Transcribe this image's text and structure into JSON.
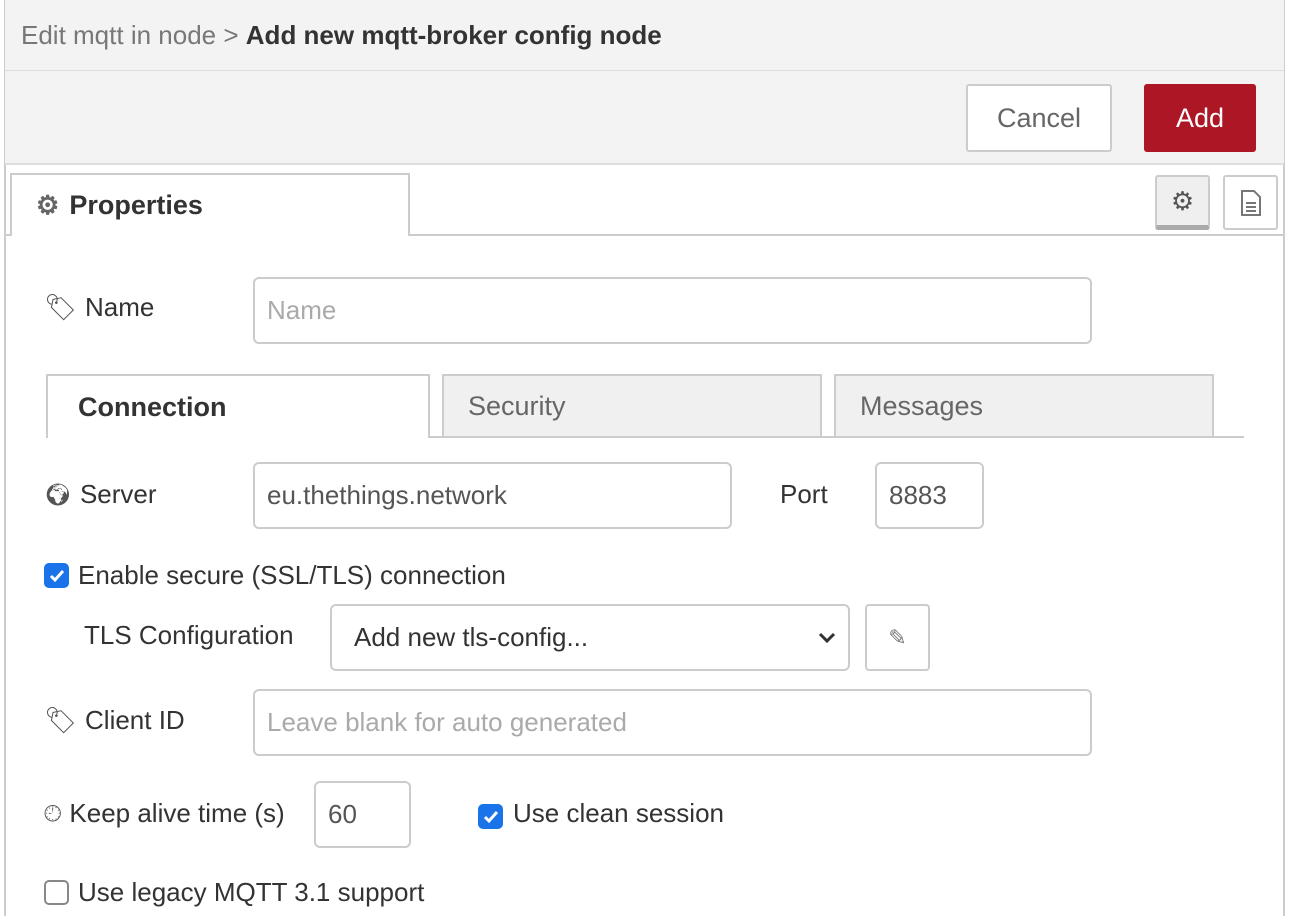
{
  "header": {
    "breadcrumb_parent": "Edit mqtt in node",
    "separator": ">",
    "title": "Add new mqtt-broker config node"
  },
  "toolbar": {
    "cancel_label": "Cancel",
    "add_label": "Add",
    "accent": "#ad1625"
  },
  "tabs": {
    "properties_label": "Properties",
    "icons": [
      "gear-icon",
      "document-icon"
    ]
  },
  "form": {
    "name": {
      "label": "Name",
      "placeholder": "Name",
      "value": ""
    },
    "subtabs": [
      "Connection",
      "Security",
      "Messages"
    ],
    "server": {
      "label": "Server",
      "value": "eu.thethings.network"
    },
    "port": {
      "label": "Port",
      "value": "8883"
    },
    "tls_enable": {
      "label": "Enable secure (SSL/TLS) connection",
      "checked": true
    },
    "tls_config": {
      "label": "TLS Configuration",
      "selected": "Add new tls-config..."
    },
    "client_id": {
      "label": "Client ID",
      "placeholder": "Leave blank for auto generated",
      "value": ""
    },
    "keepalive": {
      "label": "Keep alive time (s)",
      "value": "60"
    },
    "clean_session": {
      "label": "Use clean session",
      "checked": true
    },
    "legacy": {
      "label": "Use legacy MQTT 3.1 support",
      "checked": false
    }
  }
}
